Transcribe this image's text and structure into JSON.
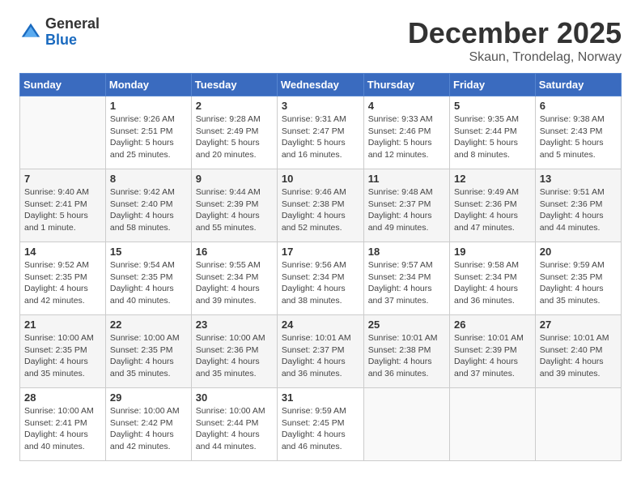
{
  "header": {
    "logo_general": "General",
    "logo_blue": "Blue",
    "month": "December 2025",
    "location": "Skaun, Trondelag, Norway"
  },
  "weekdays": [
    "Sunday",
    "Monday",
    "Tuesday",
    "Wednesday",
    "Thursday",
    "Friday",
    "Saturday"
  ],
  "weeks": [
    [
      {
        "day": "",
        "info": ""
      },
      {
        "day": "1",
        "info": "Sunrise: 9:26 AM\nSunset: 2:51 PM\nDaylight: 5 hours\nand 25 minutes."
      },
      {
        "day": "2",
        "info": "Sunrise: 9:28 AM\nSunset: 2:49 PM\nDaylight: 5 hours\nand 20 minutes."
      },
      {
        "day": "3",
        "info": "Sunrise: 9:31 AM\nSunset: 2:47 PM\nDaylight: 5 hours\nand 16 minutes."
      },
      {
        "day": "4",
        "info": "Sunrise: 9:33 AM\nSunset: 2:46 PM\nDaylight: 5 hours\nand 12 minutes."
      },
      {
        "day": "5",
        "info": "Sunrise: 9:35 AM\nSunset: 2:44 PM\nDaylight: 5 hours\nand 8 minutes."
      },
      {
        "day": "6",
        "info": "Sunrise: 9:38 AM\nSunset: 2:43 PM\nDaylight: 5 hours\nand 5 minutes."
      }
    ],
    [
      {
        "day": "7",
        "info": "Sunrise: 9:40 AM\nSunset: 2:41 PM\nDaylight: 5 hours\nand 1 minute."
      },
      {
        "day": "8",
        "info": "Sunrise: 9:42 AM\nSunset: 2:40 PM\nDaylight: 4 hours\nand 58 minutes."
      },
      {
        "day": "9",
        "info": "Sunrise: 9:44 AM\nSunset: 2:39 PM\nDaylight: 4 hours\nand 55 minutes."
      },
      {
        "day": "10",
        "info": "Sunrise: 9:46 AM\nSunset: 2:38 PM\nDaylight: 4 hours\nand 52 minutes."
      },
      {
        "day": "11",
        "info": "Sunrise: 9:48 AM\nSunset: 2:37 PM\nDaylight: 4 hours\nand 49 minutes."
      },
      {
        "day": "12",
        "info": "Sunrise: 9:49 AM\nSunset: 2:36 PM\nDaylight: 4 hours\nand 47 minutes."
      },
      {
        "day": "13",
        "info": "Sunrise: 9:51 AM\nSunset: 2:36 PM\nDaylight: 4 hours\nand 44 minutes."
      }
    ],
    [
      {
        "day": "14",
        "info": "Sunrise: 9:52 AM\nSunset: 2:35 PM\nDaylight: 4 hours\nand 42 minutes."
      },
      {
        "day": "15",
        "info": "Sunrise: 9:54 AM\nSunset: 2:35 PM\nDaylight: 4 hours\nand 40 minutes."
      },
      {
        "day": "16",
        "info": "Sunrise: 9:55 AM\nSunset: 2:34 PM\nDaylight: 4 hours\nand 39 minutes."
      },
      {
        "day": "17",
        "info": "Sunrise: 9:56 AM\nSunset: 2:34 PM\nDaylight: 4 hours\nand 38 minutes."
      },
      {
        "day": "18",
        "info": "Sunrise: 9:57 AM\nSunset: 2:34 PM\nDaylight: 4 hours\nand 37 minutes."
      },
      {
        "day": "19",
        "info": "Sunrise: 9:58 AM\nSunset: 2:34 PM\nDaylight: 4 hours\nand 36 minutes."
      },
      {
        "day": "20",
        "info": "Sunrise: 9:59 AM\nSunset: 2:35 PM\nDaylight: 4 hours\nand 35 minutes."
      }
    ],
    [
      {
        "day": "21",
        "info": "Sunrise: 10:00 AM\nSunset: 2:35 PM\nDaylight: 4 hours\nand 35 minutes."
      },
      {
        "day": "22",
        "info": "Sunrise: 10:00 AM\nSunset: 2:35 PM\nDaylight: 4 hours\nand 35 minutes."
      },
      {
        "day": "23",
        "info": "Sunrise: 10:00 AM\nSunset: 2:36 PM\nDaylight: 4 hours\nand 35 minutes."
      },
      {
        "day": "24",
        "info": "Sunrise: 10:01 AM\nSunset: 2:37 PM\nDaylight: 4 hours\nand 36 minutes."
      },
      {
        "day": "25",
        "info": "Sunrise: 10:01 AM\nSunset: 2:38 PM\nDaylight: 4 hours\nand 36 minutes."
      },
      {
        "day": "26",
        "info": "Sunrise: 10:01 AM\nSunset: 2:39 PM\nDaylight: 4 hours\nand 37 minutes."
      },
      {
        "day": "27",
        "info": "Sunrise: 10:01 AM\nSunset: 2:40 PM\nDaylight: 4 hours\nand 39 minutes."
      }
    ],
    [
      {
        "day": "28",
        "info": "Sunrise: 10:00 AM\nSunset: 2:41 PM\nDaylight: 4 hours\nand 40 minutes."
      },
      {
        "day": "29",
        "info": "Sunrise: 10:00 AM\nSunset: 2:42 PM\nDaylight: 4 hours\nand 42 minutes."
      },
      {
        "day": "30",
        "info": "Sunrise: 10:00 AM\nSunset: 2:44 PM\nDaylight: 4 hours\nand 44 minutes."
      },
      {
        "day": "31",
        "info": "Sunrise: 9:59 AM\nSunset: 2:45 PM\nDaylight: 4 hours\nand 46 minutes."
      },
      {
        "day": "",
        "info": ""
      },
      {
        "day": "",
        "info": ""
      },
      {
        "day": "",
        "info": ""
      }
    ]
  ]
}
